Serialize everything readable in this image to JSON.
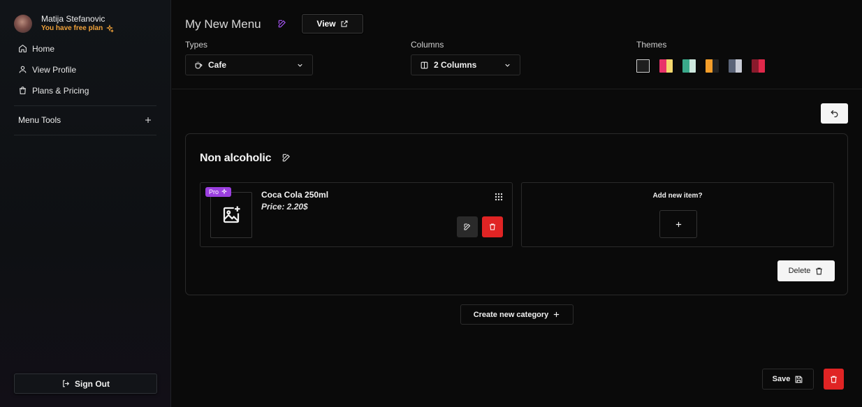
{
  "user": {
    "name": "Matija Stefanovic",
    "plan": "You have free plan"
  },
  "nav": [
    {
      "label": "Home",
      "icon": "home-icon"
    },
    {
      "label": "View Profile",
      "icon": "user-icon"
    },
    {
      "label": "Plans & Pricing",
      "icon": "bag-icon"
    }
  ],
  "menu_tools": {
    "label": "Menu Tools",
    "icon": "plus-icon"
  },
  "sign_out": {
    "label": "Sign Out",
    "icon": "sign-out-icon"
  },
  "header": {
    "title": "My New Menu",
    "view_label": "View"
  },
  "types": {
    "label": "Types",
    "value": "Cafe",
    "icon": "coffee-cup-icon"
  },
  "columns": {
    "label": "Columns",
    "value": "2 Columns",
    "icon": "columns-icon"
  },
  "themes": {
    "label": "Themes",
    "swatches": [
      {
        "name": "theme-default",
        "colors": [
          "#1e1e1e"
        ]
      },
      {
        "name": "theme-pink-yellow",
        "colors": [
          "#e8336a",
          "#f5d76e"
        ]
      },
      {
        "name": "theme-teal",
        "colors": [
          "#3aa98a",
          "#cde8de"
        ]
      },
      {
        "name": "theme-orange",
        "colors": [
          "#f59e2a",
          "#222222"
        ]
      },
      {
        "name": "theme-slate",
        "colors": [
          "#5b6478",
          "#c9ccd6"
        ]
      },
      {
        "name": "theme-crimson",
        "colors": [
          "#8a1a2c",
          "#e0284a"
        ]
      }
    ]
  },
  "category": {
    "title": "Non alcoholic",
    "items": [
      {
        "name": "Coca Cola 250ml",
        "price": "Price: 2.20$",
        "badge": "Pro"
      }
    ],
    "add_item_label": "Add new item?",
    "delete_label": "Delete"
  },
  "create_category_label": "Create new category",
  "save_label": "Save",
  "colors": {
    "accent_orange": "#f0a23a",
    "pro_purple": "#9b3fe0",
    "danger_red": "#e02424"
  }
}
